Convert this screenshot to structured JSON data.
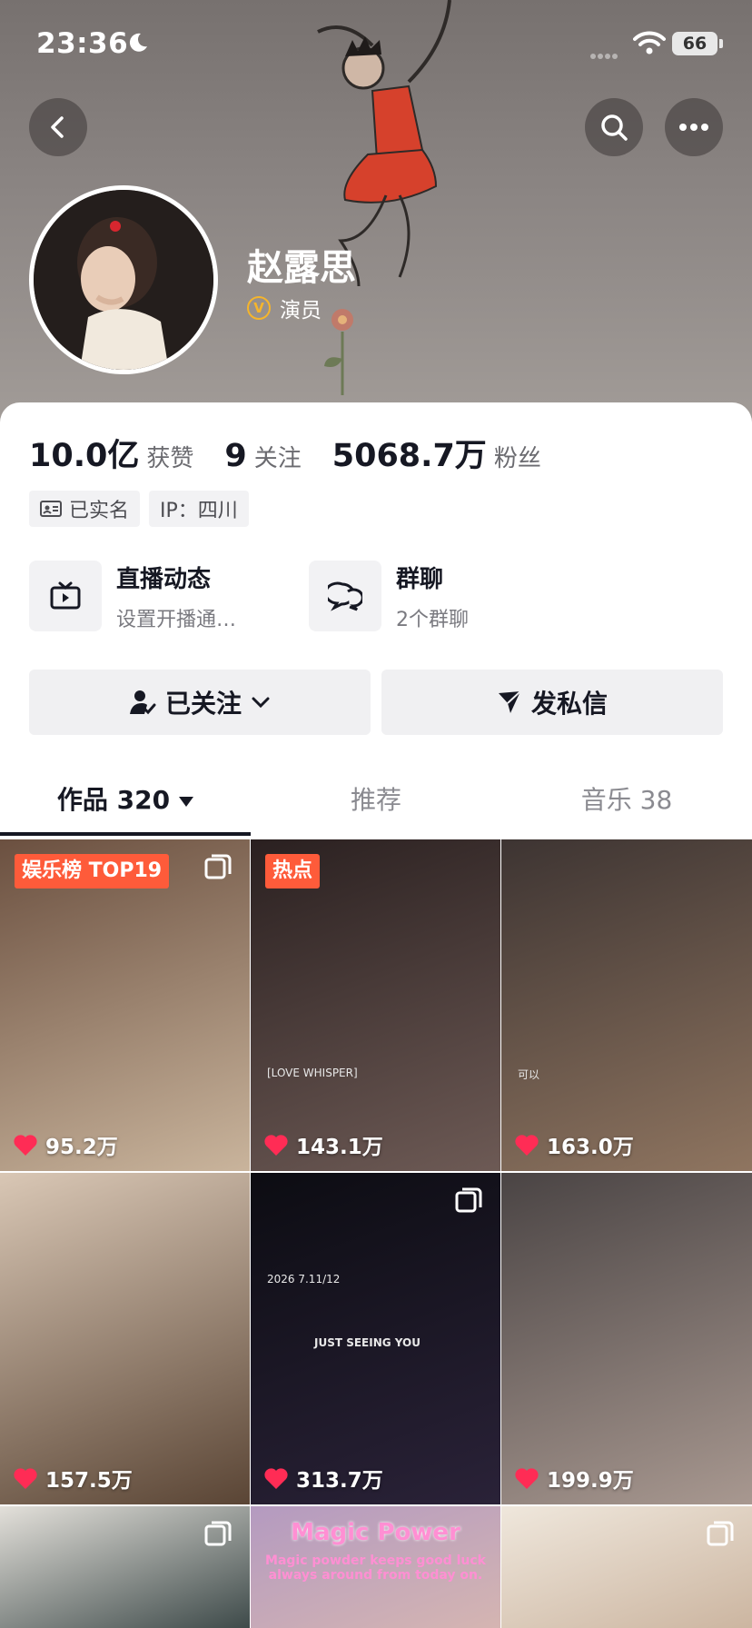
{
  "status_bar": {
    "time": "23:36",
    "battery": "66"
  },
  "profile": {
    "name": "赵露思",
    "verified_label": "演员"
  },
  "stats": [
    {
      "value": "10.0亿",
      "label": "获赞"
    },
    {
      "value": "9",
      "label": "关注"
    },
    {
      "value": "5068.7万",
      "label": "粉丝"
    }
  ],
  "tags": {
    "real_name": "已实名",
    "ip": "IP：四川"
  },
  "features": {
    "live": {
      "title": "直播动态",
      "subtitle": "设置开播通…"
    },
    "group": {
      "title": "群聊",
      "subtitle": "2个群聊"
    }
  },
  "actions": {
    "follow": "已关注",
    "message": "发私信"
  },
  "tabs": {
    "works": "作品 320",
    "recommend": "推荐",
    "music": "音乐 38"
  },
  "grid": [
    {
      "badge": "娱乐榜 TOP19",
      "likes": "95.2万",
      "multi": true,
      "colors": [
        "#6b5040",
        "#c9b49c"
      ]
    },
    {
      "badge": "热点",
      "likes": "143.1万",
      "overlay": "[LOVE WHISPER]",
      "colors": [
        "#2a2020",
        "#6d5a55"
      ]
    },
    {
      "likes": "163.0万",
      "overlay": "可以",
      "colors": [
        "#3d3432",
        "#8f7560"
      ]
    },
    {
      "likes": "157.5万",
      "colors": [
        "#d9c7b5",
        "#5a4535"
      ]
    },
    {
      "likes": "313.7万",
      "multi": true,
      "overlay": "2026 7.11/12",
      "overlay2": "JUST SEEING YOU",
      "colors": [
        "#0c0c12",
        "#2a2238"
      ]
    },
    {
      "likes": "199.9万",
      "colors": [
        "#4a4444",
        "#a89890"
      ]
    },
    {
      "multi": true,
      "colors": [
        "#e3e0da",
        "#2c3a3a"
      ]
    },
    {
      "magic_title": "Magic Power",
      "magic_sub": "Magic powder keeps good luck always around from today on.",
      "colors": [
        "#b49ac0",
        "#d8b8b0"
      ]
    },
    {
      "multi": true,
      "colors": [
        "#efe7dc",
        "#c8b09a"
      ]
    }
  ]
}
